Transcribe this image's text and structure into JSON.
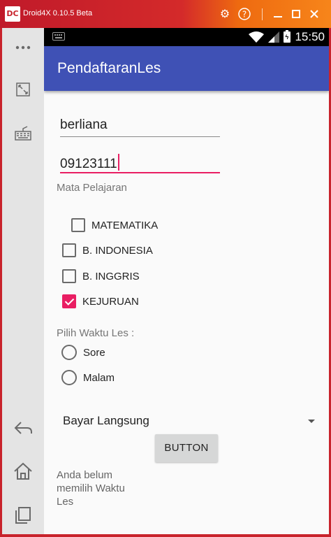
{
  "emulator": {
    "logo": "DC",
    "title": "Droid4X 0.10.5 Beta",
    "titlebar_buttons": [
      {
        "name": "settings-icon",
        "glyph": "⚙"
      },
      {
        "name": "help-icon",
        "glyph": "?"
      },
      {
        "name": "minimize-icon",
        "glyph": "—"
      },
      {
        "name": "maximize-icon",
        "glyph": "□"
      },
      {
        "name": "close-icon",
        "glyph": "✕"
      }
    ],
    "sidebar_icons": [
      "more-icon",
      "fullscreen-icon",
      "keyboard-mapping-icon",
      "back-icon",
      "home-icon",
      "recent-apps-icon"
    ]
  },
  "statusbar": {
    "time": "15:50"
  },
  "app": {
    "title": "PendaftaranLes",
    "name_field": {
      "value": "berliana"
    },
    "phone_field": {
      "value": "09123111"
    },
    "subjects_label": "Mata Pelajaran",
    "subjects": [
      {
        "label": "MATEMATIKA",
        "checked": false
      },
      {
        "label": "B. INDONESIA",
        "checked": false
      },
      {
        "label": "B. INGGRIS",
        "checked": false
      },
      {
        "label": "KEJURUAN",
        "checked": true
      }
    ],
    "time_label": "Pilih Waktu Les :",
    "time_options": [
      {
        "label": "Sore",
        "selected": false
      },
      {
        "label": "Malam",
        "selected": false
      }
    ],
    "payment_spinner": {
      "selected": "Bayar Langsung"
    },
    "button_label": "BUTTON",
    "result_text": "Anda belum memilih Waktu Les"
  },
  "colors": {
    "appbar": "#3f51b5",
    "accent": "#e91e63",
    "window_frame": "#c8232c"
  }
}
